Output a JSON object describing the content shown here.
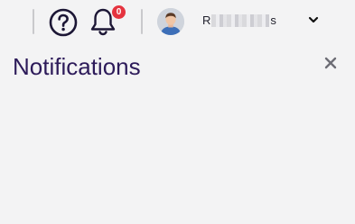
{
  "header": {
    "notifications_badge_count": "0",
    "user": {
      "name_first": "R",
      "name_last": "s",
      "name_obscured": true
    },
    "icons": {
      "help": "question-circle-icon",
      "notifications": "bell-icon",
      "menu": "chevron-down-icon"
    },
    "colors": {
      "badge": "#e5333f",
      "icon": "#1c1635",
      "title": "#2d1b5a",
      "background": "#f3f3f4"
    }
  },
  "panel": {
    "title": "Notifications",
    "close_icon": "close-icon"
  }
}
